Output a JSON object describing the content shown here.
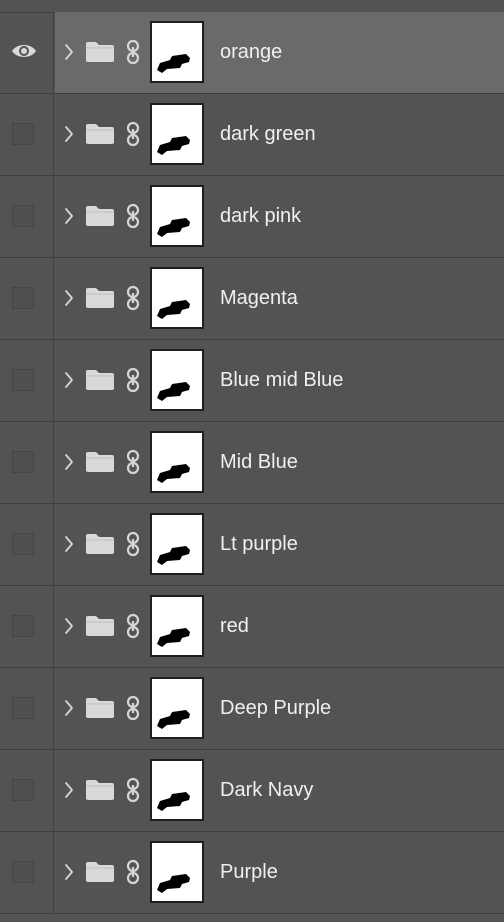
{
  "panel": {
    "title": "",
    "colors": {
      "background": "#535353",
      "selected_row": "#6a6a6a",
      "text": "#f0f0f0",
      "divider": "#3f3f3f"
    }
  },
  "layers": [
    {
      "name": "orange",
      "visible": true,
      "selected": true,
      "type": "group",
      "icon": "folder-icon",
      "has_mask": true
    },
    {
      "name": "dark green",
      "visible": false,
      "selected": false,
      "type": "group",
      "icon": "folder-icon",
      "has_mask": true
    },
    {
      "name": "dark pink",
      "visible": false,
      "selected": false,
      "type": "group",
      "icon": "folder-icon",
      "has_mask": true
    },
    {
      "name": "Magenta",
      "visible": false,
      "selected": false,
      "type": "group",
      "icon": "folder-icon",
      "has_mask": true
    },
    {
      "name": "Blue mid Blue",
      "visible": false,
      "selected": false,
      "type": "group",
      "icon": "folder-icon",
      "has_mask": true
    },
    {
      "name": "Mid Blue",
      "visible": false,
      "selected": false,
      "type": "group",
      "icon": "folder-icon",
      "has_mask": true
    },
    {
      "name": "Lt purple",
      "visible": false,
      "selected": false,
      "type": "group",
      "icon": "folder-icon",
      "has_mask": true
    },
    {
      "name": "red",
      "visible": false,
      "selected": false,
      "type": "group",
      "icon": "folder-icon",
      "has_mask": true
    },
    {
      "name": "Deep Purple",
      "visible": false,
      "selected": false,
      "type": "group",
      "icon": "folder-icon",
      "has_mask": true
    },
    {
      "name": "Dark Navy",
      "visible": false,
      "selected": false,
      "type": "group",
      "icon": "folder-icon",
      "has_mask": true
    },
    {
      "name": "Purple",
      "visible": false,
      "selected": false,
      "type": "group",
      "icon": "folder-icon",
      "has_mask": true
    }
  ]
}
